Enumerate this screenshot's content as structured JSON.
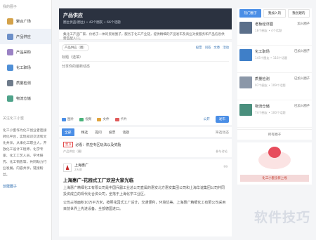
{
  "left": {
    "section_title": "我的圈子",
    "items": [
      {
        "label": "聚合广场",
        "icon": "plaza-icon",
        "color": "#d4a24a"
      },
      {
        "label": "产品供应",
        "icon": "supply-icon",
        "color": "#6c8fc8"
      },
      {
        "label": "产品采购",
        "icon": "purchase-icon",
        "color": "#9a82c4"
      },
      {
        "label": "化工职场",
        "icon": "work-icon",
        "color": "#4f8fd6"
      },
      {
        "label": "质量检测",
        "icon": "quality-icon",
        "color": "#6e7b8b"
      },
      {
        "label": "物流仓储",
        "icon": "logistics-icon",
        "color": "#4fa38a"
      }
    ],
    "about_title": "关注化工小蜜",
    "about_text": "化工小蜜作为化工创业者连接转化平台，实现知识交流和文化共享。从事化工职业人，开放化工设计工程师、化学专家、化工工艺人员、学术研究、化工销售等，共同助力行业发展，内容共享，链接粉丝。",
    "link": "创建圈子"
  },
  "center": {
    "header": {
      "title": "产品供应",
      "meta": "圈主优品(圈主) • 42个圈友 • 66个话题"
    },
    "intro": "集化工产品厂家、价格于一体的贸易圈子，服务于化工产业链，提供精细的产品发布及商业对接服务和产品信息供需匹配入口。",
    "editor": {
      "circle_pill": "产品供应（圈）",
      "actions": [
        "投票",
        "问答",
        "文章",
        "活动"
      ],
      "title_placeholder": "标题（选填）",
      "body_placeholder": "分享你的最新动态",
      "tools": [
        "图片",
        "视频",
        "文件",
        "卡片"
      ],
      "publish_scope": "公开",
      "submit": "发布"
    },
    "tabs": [
      "全部",
      "精选",
      "提问",
      "投票",
      "话题"
    ],
    "tabs_more": "筛选动态",
    "notice": {
      "badge": "置顶",
      "title": "必看：供应专区玩法以及奖励",
      "meta": "产品供应（圈）",
      "meta_right": "参与讨论"
    },
    "post": {
      "author": "上海惠广",
      "time": "2天前",
      "count": "99",
      "title": "上海惠广-花园式工厂欢迎大家光临",
      "para1": "上海惠广精细化工有限公司是中国兵器工业总公司直属的惠安北方惠安集团公司和上海华谊集团公司共同投资成立的现代化合资公司，坐落于上海化学工业区。",
      "para2": "公司占地面积10万平方米，按照花园式工厂设计，交通便利，环境优美。上海惠广精细化工有限公司采用目前世界上先进设备，全部德国进口。"
    }
  },
  "right": {
    "tabs": [
      "热门圈子",
      "我加入的",
      "我创建的"
    ],
    "items": [
      {
        "name": "老板经济圈",
        "status": "加入圈子",
        "meta": "18个圈友 • 4个话题",
        "color": "#5b6f8a"
      },
      {
        "name": "化工职场",
        "status": "已加入圈子",
        "meta": "145个圈友 • 116个话题",
        "color": "#3f7fc8"
      },
      {
        "name": "质量检测",
        "status": "已加入圈子",
        "meta": "97个圈友 • 109个话题",
        "color": "#8b97a8"
      },
      {
        "name": "物流仓储",
        "status": "已加入圈子",
        "meta": "74个圈友 • 100个话题",
        "color": "#4a8f7d"
      }
    ],
    "all": "所有圈子",
    "banner_text": "化工小蜜全新上线"
  },
  "watermark": "软件技巧"
}
